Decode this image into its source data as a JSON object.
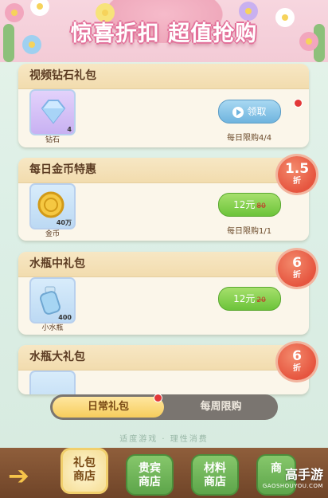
{
  "banner": {
    "title": "惊喜折扣 超值抢购"
  },
  "cards": [
    {
      "title": "视频钻石礼包",
      "item_label": "钻石",
      "item_qty": "4",
      "button_label": "领取",
      "limit": "每日限购4/4"
    },
    {
      "title": "每日金币特惠",
      "item_label": "金币",
      "item_qty": "40万",
      "price": "12元",
      "old_price": "80",
      "limit": "每日限购1/1",
      "discount": "1.5",
      "discount_unit": "折"
    },
    {
      "title": "水瓶中礼包",
      "item_label": "小水瓶",
      "item_qty": "400",
      "price": "12元",
      "old_price": "20",
      "discount": "6",
      "discount_unit": "折"
    },
    {
      "title": "水瓶大礼包",
      "discount": "6",
      "discount_unit": "折"
    }
  ],
  "tabs": {
    "active": "日常礼包",
    "inactive": "每周限购"
  },
  "slogan": "适度游戏 · 理性消费",
  "bottom_nav": [
    {
      "line1": "礼包",
      "line2": "商店"
    },
    {
      "line1": "贵宾",
      "line2": "商店"
    },
    {
      "line1": "材料",
      "line2": "商店"
    },
    {
      "line1": "商",
      "line2": ""
    }
  ],
  "watermark": {
    "name": "高手游",
    "url": "GAOSHOUYOU.COM"
  },
  "colors": {
    "accent_green": "#6cc33a",
    "accent_blue": "#6fb4de",
    "badge_red": "#e6553f"
  }
}
